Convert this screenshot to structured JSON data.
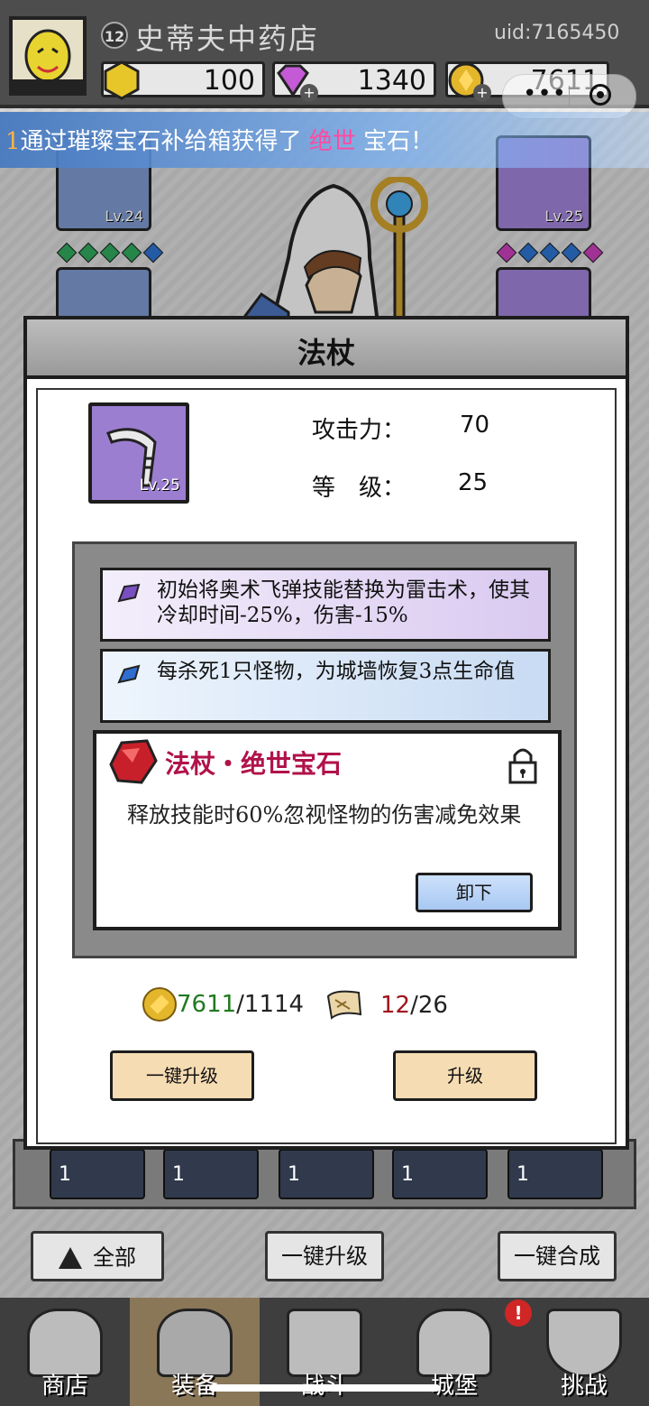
{
  "header": {
    "level": "12",
    "shop_name": "史蒂夫中药店",
    "uid": "uid:7165450",
    "resources": [
      {
        "icon": "hexagon-gold-icon",
        "value": "100"
      },
      {
        "icon": "purple-diamond-icon",
        "value": "1340"
      },
      {
        "icon": "gold-coin-icon",
        "value": "7611"
      }
    ]
  },
  "announcement": {
    "prefix": "1",
    "text_before": "通过璀璨宝石补给箱获得了",
    "highlight": "绝世",
    "text_after": "宝石！"
  },
  "background_slots": {
    "left_top_level": "Lv.24",
    "right_top_level": "Lv.25"
  },
  "modal": {
    "title": "法杖",
    "item_level": "Lv.25",
    "stats": [
      {
        "label": "攻击力：",
        "value": "70"
      },
      {
        "label": "等　级：",
        "value": "25"
      }
    ],
    "traits": [
      {
        "gem": "purple-gem-icon",
        "text": "初始将奥术飞弹技能替换为雷击术，使其冷却时间-25%，伤害-15%"
      },
      {
        "gem": "blue-gem-icon",
        "text": "每杀死1只怪物，为城墙恢复3点生命值"
      }
    ],
    "gem_card": {
      "title": "法杖・绝世宝石",
      "description": "释放技能时60%忽视怪物的伤害减免效果",
      "unequip_label": "卸下"
    },
    "costs": {
      "coin_have": "7611",
      "coin_need": "/1114",
      "scroll_have": "12",
      "scroll_need": "/26"
    },
    "buttons": {
      "one_click_upgrade": "一键升级",
      "upgrade": "升级"
    }
  },
  "gem_shelf": [
    "1",
    "1",
    "1",
    "1",
    "1"
  ],
  "filters": {
    "all": "全部",
    "one_click_upgrade": "一键升级",
    "one_click_merge": "一键合成"
  },
  "nav": [
    {
      "label": "商店"
    },
    {
      "label": "装备"
    },
    {
      "label": "战斗"
    },
    {
      "label": "城堡"
    },
    {
      "label": "挑战"
    }
  ],
  "nav_badge": "!",
  "colors": {
    "announcement_highlight": "#ff4aa0",
    "gem_card_title": "#b0124a",
    "coin_have": "#1f7a1f",
    "scroll_have": "#a0141e"
  }
}
